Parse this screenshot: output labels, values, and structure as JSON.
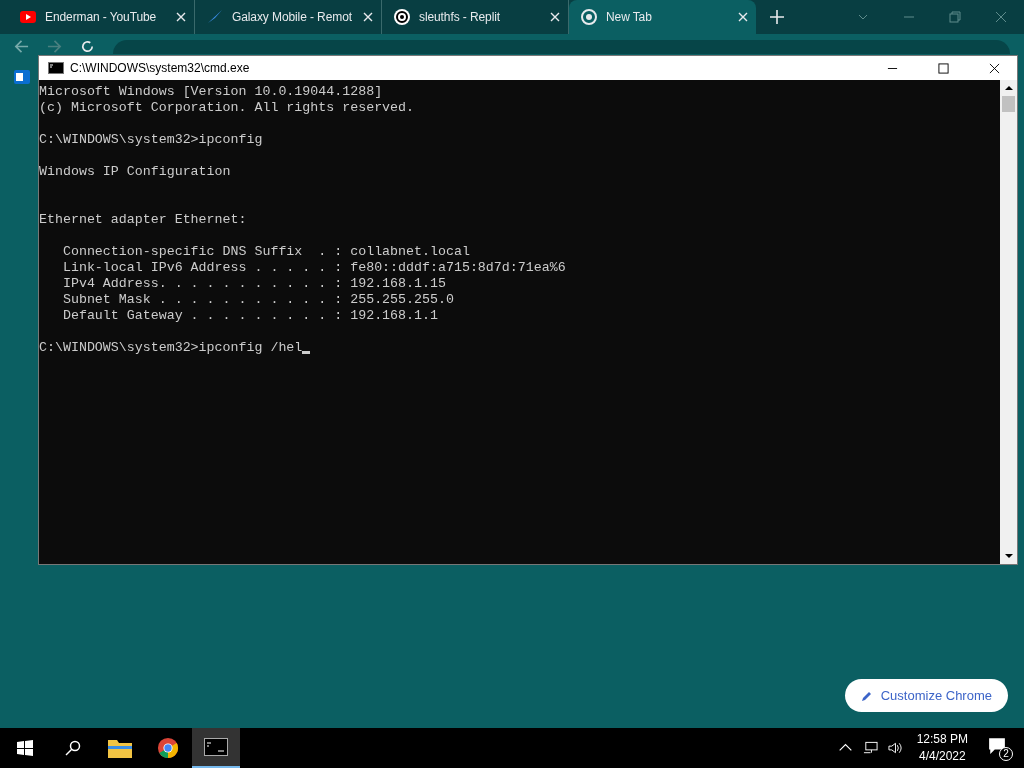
{
  "browser": {
    "tabs": [
      {
        "title": "Enderman - YouTube",
        "kind": "youtube",
        "selected": false
      },
      {
        "title": "Galaxy Mobile - Remot",
        "kind": "galaxy",
        "selected": false
      },
      {
        "title": "sleuthfs - Replit",
        "kind": "replit",
        "selected": false
      },
      {
        "title": "New Tab",
        "kind": "chrome",
        "selected": true
      }
    ],
    "customize_button": "Customize Chrome"
  },
  "cmd": {
    "title": "C:\\WINDOWS\\system32\\cmd.exe",
    "cursor": true,
    "blocks": [
      {
        "kind": "output",
        "lines": [
          "Microsoft Windows [Version 10.0.19044.1288]",
          "(c) Microsoft Corporation. All rights reserved."
        ]
      },
      {
        "kind": "output",
        "lines": [
          "C:\\WINDOWS\\system32>ipconfig"
        ]
      },
      {
        "kind": "header",
        "lines": [
          "Windows IP Configuration"
        ]
      },
      {
        "kind": "output",
        "lines": [
          "Ethernet adapter Ethernet:"
        ]
      },
      {
        "kind": "output",
        "lines": [
          "   Connection-specific DNS Suffix  . : collabnet.local",
          "   Link-local IPv6 Address . . . . . : fe80::dddf:a715:8d7d:71ea%6",
          "   IPv4 Address. . . . . . . . . . . : 192.168.1.15",
          "   Subnet Mask . . . . . . . . . . . : 255.255.255.0",
          "   Default Gateway . . . . . . . . . : 192.168.1.1"
        ]
      },
      {
        "kind": "prompt",
        "lines": [
          "C:\\WINDOWS\\system32>ipconfig /hel"
        ]
      }
    ]
  },
  "taskbar": {
    "apps": [
      {
        "kind": "folder",
        "selected": false
      },
      {
        "kind": "chrome",
        "selected": false
      },
      {
        "kind": "terminal",
        "selected": true
      }
    ],
    "time": "12:58 PM",
    "date": "4/4/2022",
    "notifications": "2"
  }
}
